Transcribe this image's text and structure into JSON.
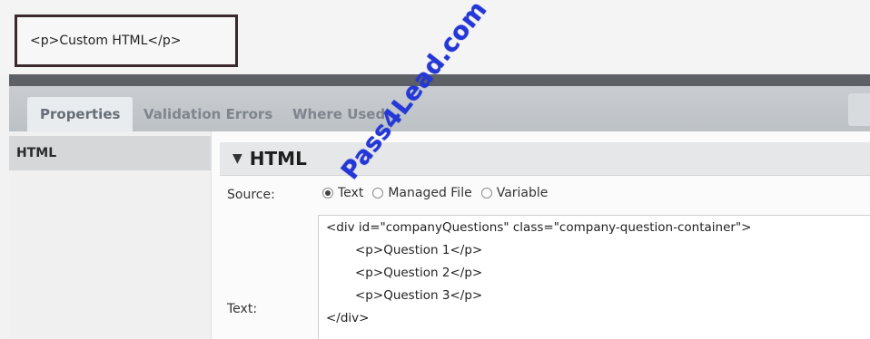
{
  "preview": {
    "text": "<p>Custom HTML</p>"
  },
  "tabs": [
    {
      "label": "Properties",
      "active": true
    },
    {
      "label": "Validation Errors"
    },
    {
      "label": "Where Used"
    }
  ],
  "left_panel": {
    "items": [
      "HTML"
    ]
  },
  "section": {
    "title": "HTML",
    "arrow": "▼"
  },
  "source": {
    "label": "Source:",
    "options": [
      {
        "label": "Text",
        "checked": true
      },
      {
        "label": "Managed File"
      },
      {
        "label": "Variable"
      }
    ]
  },
  "text_field": {
    "label": "Text:",
    "lines": [
      "<div id=\"companyQuestions\" class=\"company-question-container\">",
      "<p>Question 1</p>",
      "<p>Question 2</p>",
      "<p>Question 3</p>",
      "</div>"
    ]
  },
  "watermark": "Pass4Lead.com",
  "colors": {
    "watermark": "#2437d8",
    "tab_bar": "#c4c8cc",
    "dark_bar": "#5d6166"
  }
}
